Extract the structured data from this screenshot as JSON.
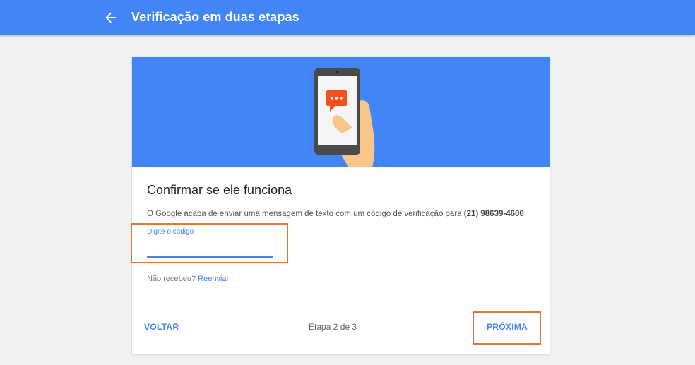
{
  "header": {
    "title": "Verificação em duas etapas",
    "back_icon": "arrow-left-icon"
  },
  "illustration": {
    "icons": [
      "phone-icon",
      "chat-bubble-icon",
      "hand-icon"
    ],
    "colors": {
      "background": "#4285f4",
      "phone": "#4a4a4a",
      "screen": "#f5f5f5",
      "bubble": "#f4511e",
      "hand": "#f9c68a"
    }
  },
  "card": {
    "heading": "Confirmar se ele funciona",
    "description": "O Google acaba de enviar uma mensagem de texto com um código de verificação para ",
    "phone_number": "(21) 98639-4600",
    "description_end": ".",
    "code_field": {
      "label": "Digite o código",
      "value": ""
    },
    "resend_prefix": "Não recebeu?",
    "resend_link": "Reenviar",
    "back_button": "VOLTAR",
    "step_text": "Etapa 2 de 3",
    "next_button": "PRÓXIMA"
  },
  "colors": {
    "accent": "#4285f4",
    "highlight": "#e0763a",
    "background": "#f1f1f1"
  }
}
